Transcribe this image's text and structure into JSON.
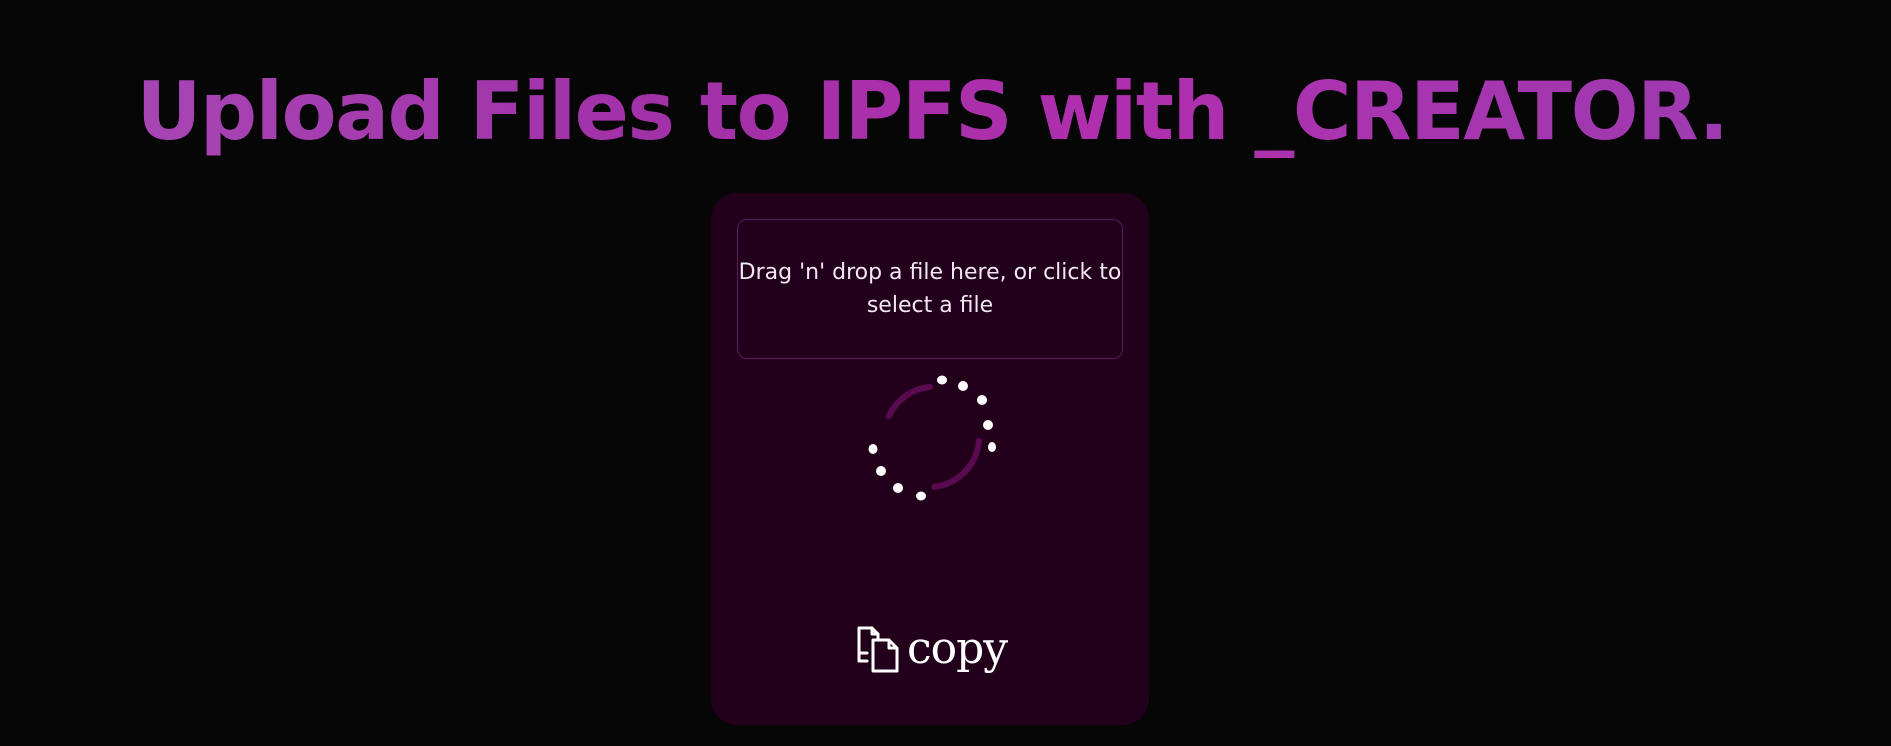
{
  "page": {
    "title": "Upload Files to IPFS with _CREATOR."
  },
  "uploader": {
    "dropzone_text": "Drag 'n' drop a file here, or click to select a file",
    "copy_label": "copy",
    "copy_icon": "copy-icon",
    "loading_icon": "loading-spinner"
  },
  "colors": {
    "background": "#060606",
    "card": "#22001c",
    "title_gradient_start": "#a94ab8",
    "title_gradient_end": "#9a3db0",
    "spinner_arc": "#5a0a4f",
    "spinner_dots": "#ffffff"
  }
}
